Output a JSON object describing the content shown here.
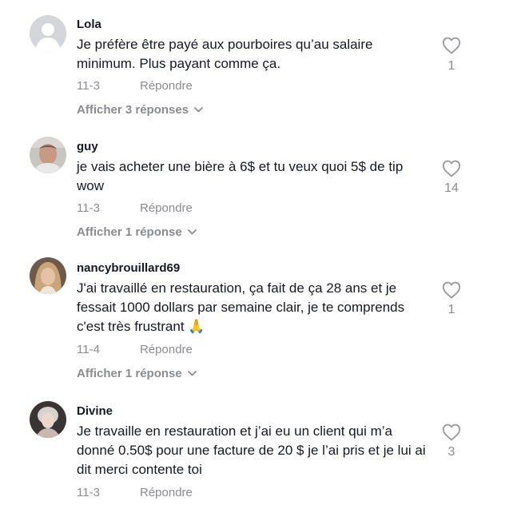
{
  "comments": [
    {
      "username": "Lola",
      "text": "Je préfère être payé aux pourboires qu’au salaire minimum. Plus payant comme ça.",
      "date": "11-3",
      "reply_label": "Répondre",
      "view_replies": "Afficher 3 réponses",
      "likes": "1",
      "avatar": "default-avatar"
    },
    {
      "username": "guy",
      "text": "je vais acheter une bière à 6$ et tu veux quoi 5$ de tip wow",
      "date": "11-3",
      "reply_label": "Répondre",
      "view_replies": "Afficher 1 réponse",
      "likes": "14",
      "avatar": "man-photo"
    },
    {
      "username": "nancybrouillard69",
      "text": "J'ai travaillé en restauration, ça fait de ça 28 ans et je fessait 1000 dollars par semaine clair, je te comprends c'est très frustrant 🙏",
      "date": "11-4",
      "reply_label": "Répondre",
      "view_replies": "Afficher 1 réponse",
      "likes": "1",
      "avatar": "woman-photo"
    },
    {
      "username": "Divine",
      "text": "Je travaille en restauration et j’ai eu un client qui m’a donné 0.50$ pour une facture de 20 $ je l’ai pris et je lui ai dit merci contente toi",
      "date": "11-3",
      "reply_label": "Répondre",
      "likes": "3",
      "avatar": "woman-photo"
    }
  ],
  "icons": {
    "like": "heart-outline-icon",
    "expand": "chevron-down-icon"
  },
  "colors": {
    "text": "#161823",
    "secondary": "#8a8b91",
    "icon": "#9b9ca1"
  }
}
